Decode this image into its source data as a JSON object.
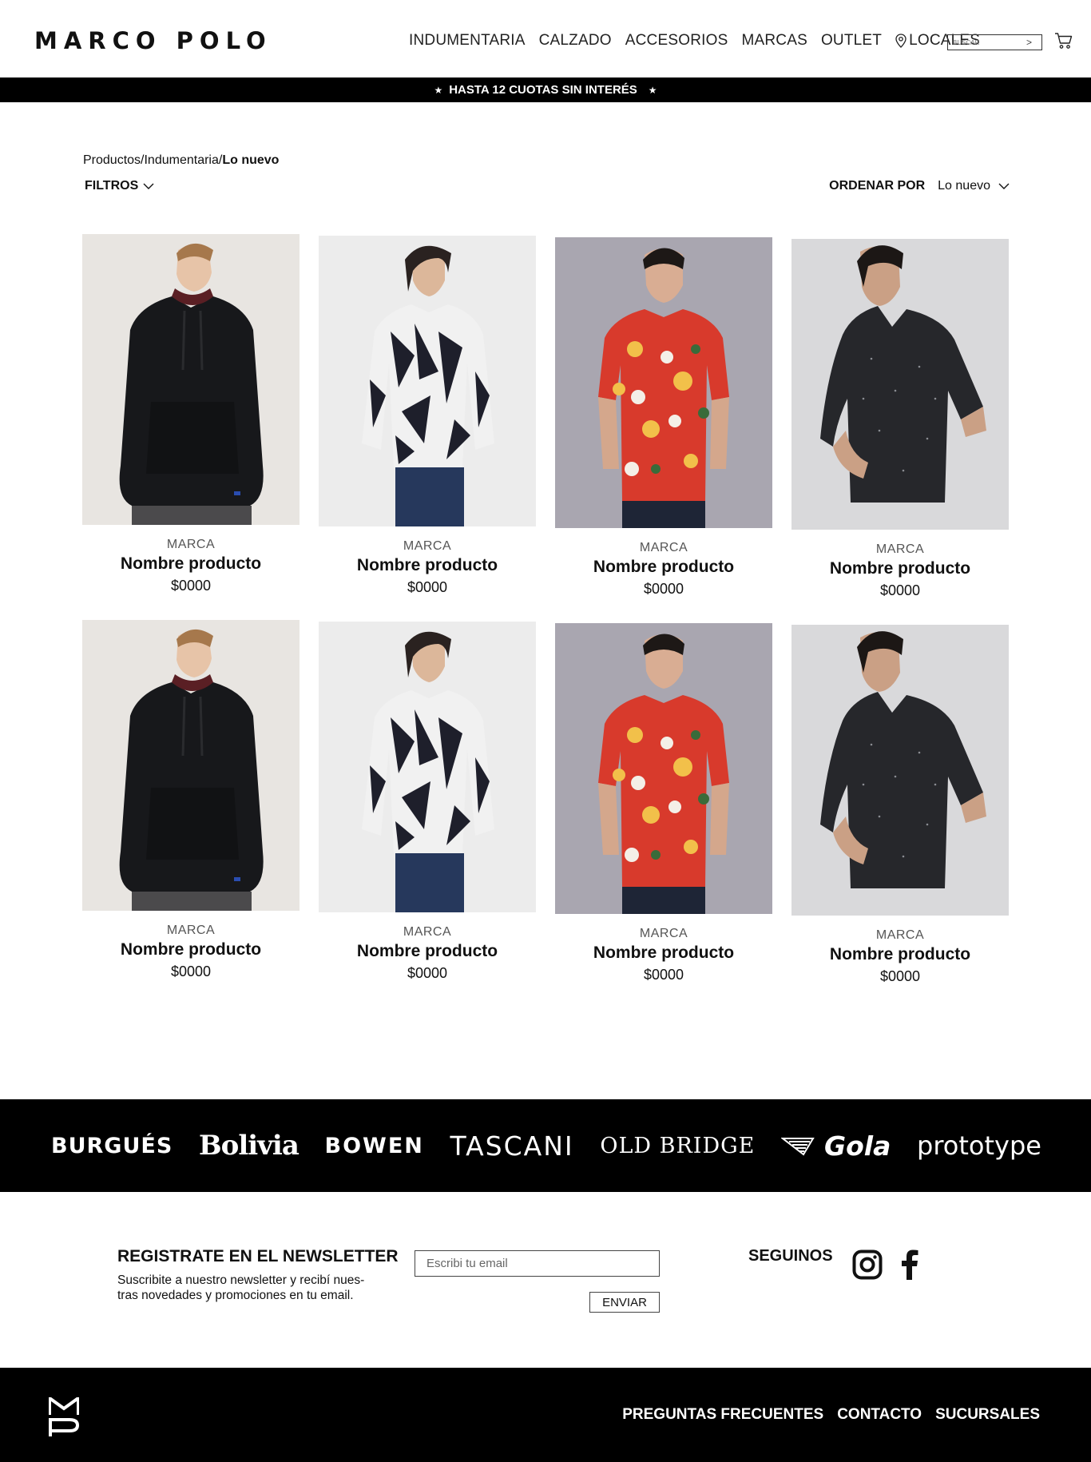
{
  "header": {
    "logo": "MARCO POLO",
    "nav": [
      "INDUMENTARIA",
      "CALZADO",
      "ACCESORIOS",
      "MARCAS",
      "OUTLET",
      "LOCALES"
    ],
    "search_placeholder": "BUSCAR",
    "search_go": ">"
  },
  "promo": {
    "text": "HASTA 12 CUOTAS SIN INTERÉS",
    "star": "★"
  },
  "breadcrumb": {
    "part1": "Productos/",
    "part2": "Indumentaria/",
    "current": "Lo nuevo"
  },
  "toolbar": {
    "filters": "FILTROS",
    "order_label": "ORDENAR POR",
    "order_value": "Lo nuevo"
  },
  "products": [
    {
      "brand": "MARCA",
      "name": "Nombre producto",
      "price": "$0000"
    },
    {
      "brand": "MARCA",
      "name": "Nombre producto",
      "price": "$0000"
    },
    {
      "brand": "MARCA",
      "name": "Nombre producto",
      "price": "$0000"
    },
    {
      "brand": "MARCA",
      "name": "Nombre producto",
      "price": "$0000"
    },
    {
      "brand": "MARCA",
      "name": "Nombre producto",
      "price": "$0000"
    },
    {
      "brand": "MARCA",
      "name": "Nombre producto",
      "price": "$0000"
    },
    {
      "brand": "MARCA",
      "name": "Nombre producto",
      "price": "$0000"
    },
    {
      "brand": "MARCA",
      "name": "Nombre producto",
      "price": "$0000"
    }
  ],
  "brands": [
    "BURGUÉS",
    "Bolivia",
    "BOWEN",
    "TASCANI",
    "OLD BRIDGE",
    "Gola",
    "prototype"
  ],
  "newsletter": {
    "title": "REGISTRATE EN EL NEWSLETTER",
    "text": "Suscribite a nuestro newsletter y recibí nues-tras novedades y promociones en tu email.",
    "placeholder": "Escribi tu email",
    "button": "ENVIAR"
  },
  "social": {
    "title": "SEGUINOS",
    "icons": [
      "instagram-icon",
      "facebook-icon"
    ]
  },
  "footer": {
    "logo": "MP",
    "links": [
      "PREGUNTAS FRECUENTES",
      "CONTACTO",
      "SUCURSALES"
    ]
  },
  "colors": {
    "black": "#000000",
    "white": "#ffffff",
    "text": "#111111"
  }
}
